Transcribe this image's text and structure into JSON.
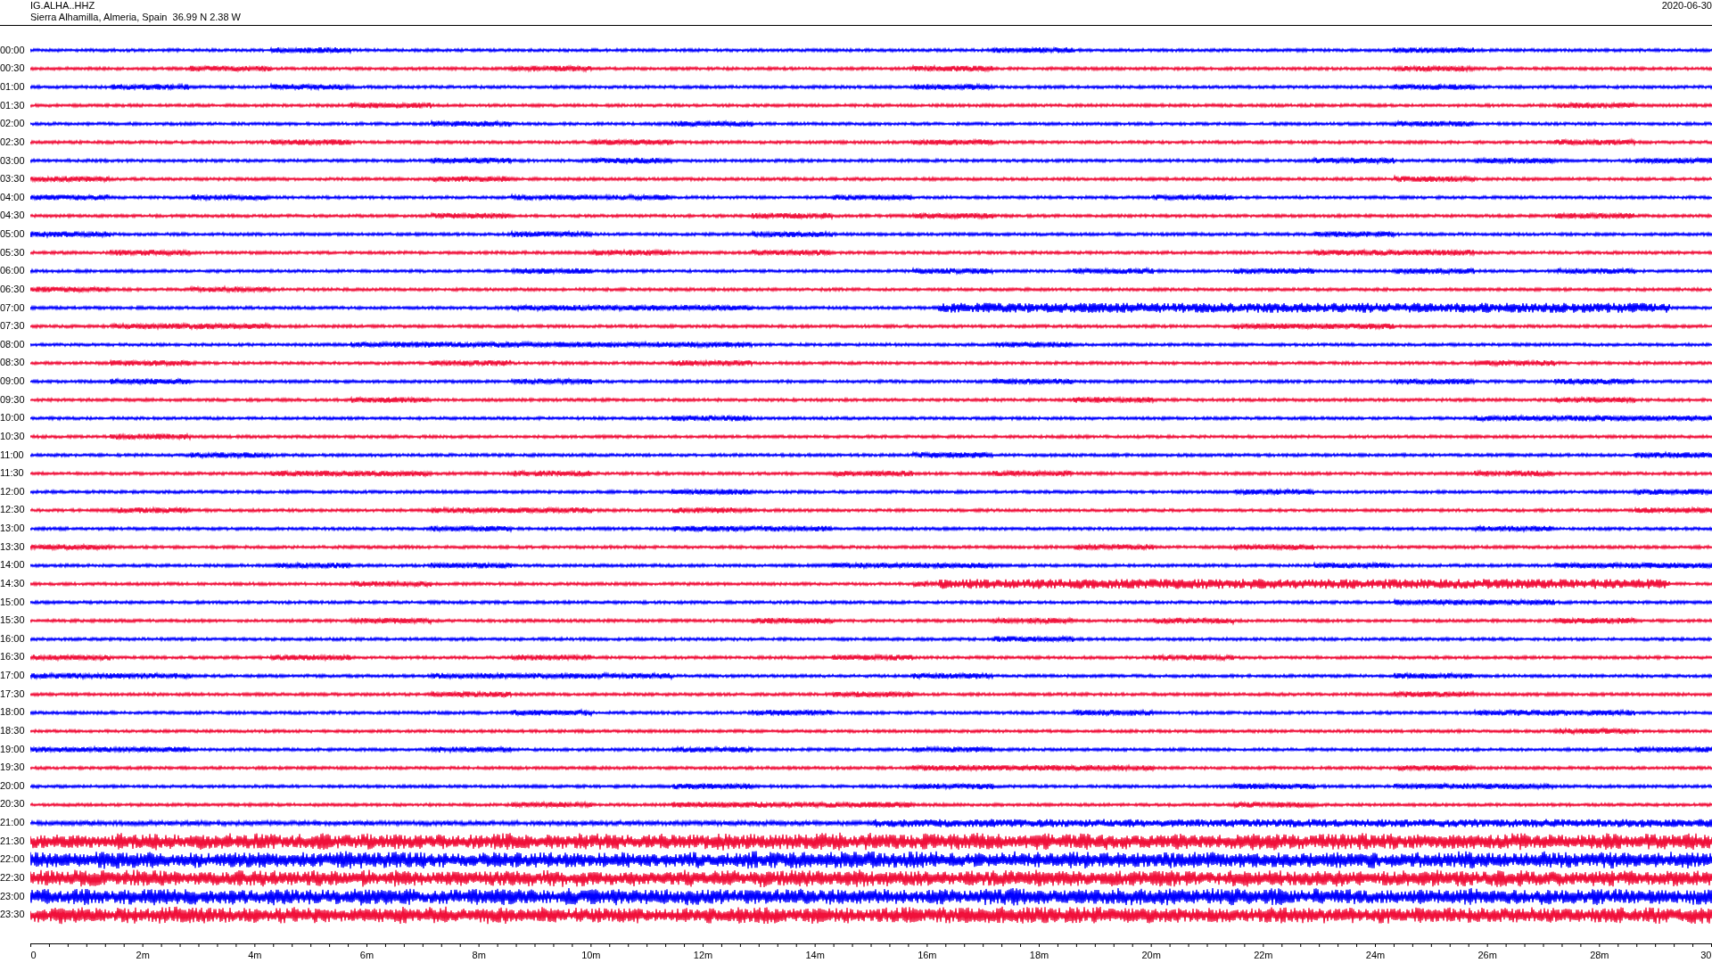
{
  "header": {
    "station": "IG.ALHA..HHZ",
    "location": "Sierra Alhamilla, Almeria, Spain  36.99 N 2.38 W",
    "date": "2020-06-30"
  },
  "rows": [
    {
      "time": "00:00",
      "color": "#0000ff",
      "kind": "quiet"
    },
    {
      "time": "00:30",
      "color": "#f0103a",
      "kind": "quiet"
    },
    {
      "time": "01:00",
      "color": "#0000ff",
      "kind": "quiet"
    },
    {
      "time": "01:30",
      "color": "#f0103a",
      "kind": "quiet"
    },
    {
      "time": "02:00",
      "color": "#0000ff",
      "kind": "quiet"
    },
    {
      "time": "02:30",
      "color": "#f0103a",
      "kind": "quiet"
    },
    {
      "time": "03:00",
      "color": "#0000ff",
      "kind": "quiet"
    },
    {
      "time": "03:30",
      "color": "#f0103a",
      "kind": "quiet"
    },
    {
      "time": "04:00",
      "color": "#0000ff",
      "kind": "quiet"
    },
    {
      "time": "04:30",
      "color": "#f0103a",
      "kind": "quiet"
    },
    {
      "time": "05:00",
      "color": "#0000ff",
      "kind": "quiet"
    },
    {
      "time": "05:30",
      "color": "#f0103a",
      "kind": "quiet"
    },
    {
      "time": "06:00",
      "color": "#0000ff",
      "kind": "quiet"
    },
    {
      "time": "06:30",
      "color": "#f0103a",
      "kind": "quiet"
    },
    {
      "time": "07:00",
      "color": "#0000ff",
      "kind": "event"
    },
    {
      "time": "07:30",
      "color": "#f0103a",
      "kind": "quiet"
    },
    {
      "time": "08:00",
      "color": "#0000ff",
      "kind": "quiet"
    },
    {
      "time": "08:30",
      "color": "#f0103a",
      "kind": "quiet"
    },
    {
      "time": "09:00",
      "color": "#0000ff",
      "kind": "quiet"
    },
    {
      "time": "09:30",
      "color": "#f0103a",
      "kind": "quiet"
    },
    {
      "time": "10:00",
      "color": "#0000ff",
      "kind": "quiet"
    },
    {
      "time": "10:30",
      "color": "#f0103a",
      "kind": "quiet"
    },
    {
      "time": "11:00",
      "color": "#0000ff",
      "kind": "quiet"
    },
    {
      "time": "11:30",
      "color": "#f0103a",
      "kind": "quiet"
    },
    {
      "time": "12:00",
      "color": "#0000ff",
      "kind": "quiet"
    },
    {
      "time": "12:30",
      "color": "#f0103a",
      "kind": "quiet"
    },
    {
      "time": "13:00",
      "color": "#0000ff",
      "kind": "quiet"
    },
    {
      "time": "13:30",
      "color": "#f0103a",
      "kind": "quiet"
    },
    {
      "time": "14:00",
      "color": "#0000ff",
      "kind": "quiet"
    },
    {
      "time": "14:30",
      "color": "#f0103a",
      "kind": "event"
    },
    {
      "time": "15:00",
      "color": "#0000ff",
      "kind": "quiet"
    },
    {
      "time": "15:30",
      "color": "#f0103a",
      "kind": "quiet"
    },
    {
      "time": "16:00",
      "color": "#0000ff",
      "kind": "quiet"
    },
    {
      "time": "16:30",
      "color": "#f0103a",
      "kind": "quiet"
    },
    {
      "time": "17:00",
      "color": "#0000ff",
      "kind": "quiet"
    },
    {
      "time": "17:30",
      "color": "#f0103a",
      "kind": "quiet"
    },
    {
      "time": "18:00",
      "color": "#0000ff",
      "kind": "quiet"
    },
    {
      "time": "18:30",
      "color": "#f0103a",
      "kind": "quiet"
    },
    {
      "time": "19:00",
      "color": "#0000ff",
      "kind": "quiet"
    },
    {
      "time": "19:30",
      "color": "#f0103a",
      "kind": "quiet"
    },
    {
      "time": "20:00",
      "color": "#0000ff",
      "kind": "quiet"
    },
    {
      "time": "20:30",
      "color": "#f0103a",
      "kind": "quiet"
    },
    {
      "time": "21:00",
      "color": "#0000ff",
      "kind": "rising"
    },
    {
      "time": "21:30",
      "color": "#f0103a",
      "kind": "noisy"
    },
    {
      "time": "22:00",
      "color": "#0000ff",
      "kind": "noisy"
    },
    {
      "time": "22:30",
      "color": "#f0103a",
      "kind": "noisy"
    },
    {
      "time": "23:00",
      "color": "#0000ff",
      "kind": "noisy"
    },
    {
      "time": "23:30",
      "color": "#f0103a",
      "kind": "noisy"
    }
  ],
  "x_axis": {
    "labels": [
      "0",
      "2m",
      "4m",
      "6m",
      "8m",
      "10m",
      "12m",
      "14m",
      "16m",
      "18m",
      "20m",
      "22m",
      "24m",
      "26m",
      "28m",
      "30"
    ]
  }
}
